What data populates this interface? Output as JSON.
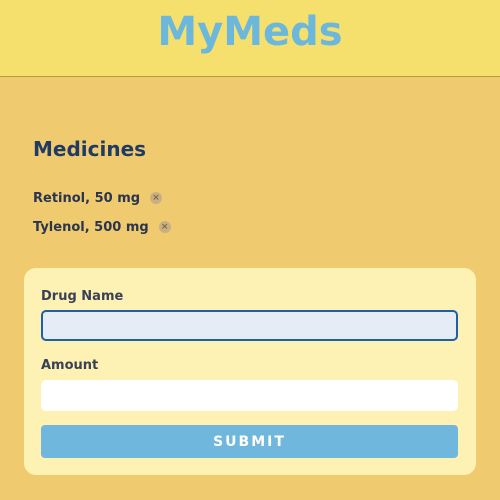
{
  "header": {
    "title": "MyMeds"
  },
  "medicines": {
    "title": "Medicines",
    "items": [
      {
        "label": "Retinol, 50 mg",
        "remove_icon": "×"
      },
      {
        "label": "Tylenol, 500 mg",
        "remove_icon": "×"
      }
    ]
  },
  "form": {
    "drug_name_label": "Drug Name",
    "drug_name_value": "",
    "amount_label": "Amount",
    "amount_value": "",
    "submit_label": "SUBMIT"
  },
  "colors": {
    "header_bg": "#f5e06e",
    "page_bg": "#f0ca6e",
    "title": "#6cb8dc",
    "card_bg": "#fdf2b4",
    "button_bg": "#6fb7dc",
    "focus_border": "#1e5fa8"
  }
}
